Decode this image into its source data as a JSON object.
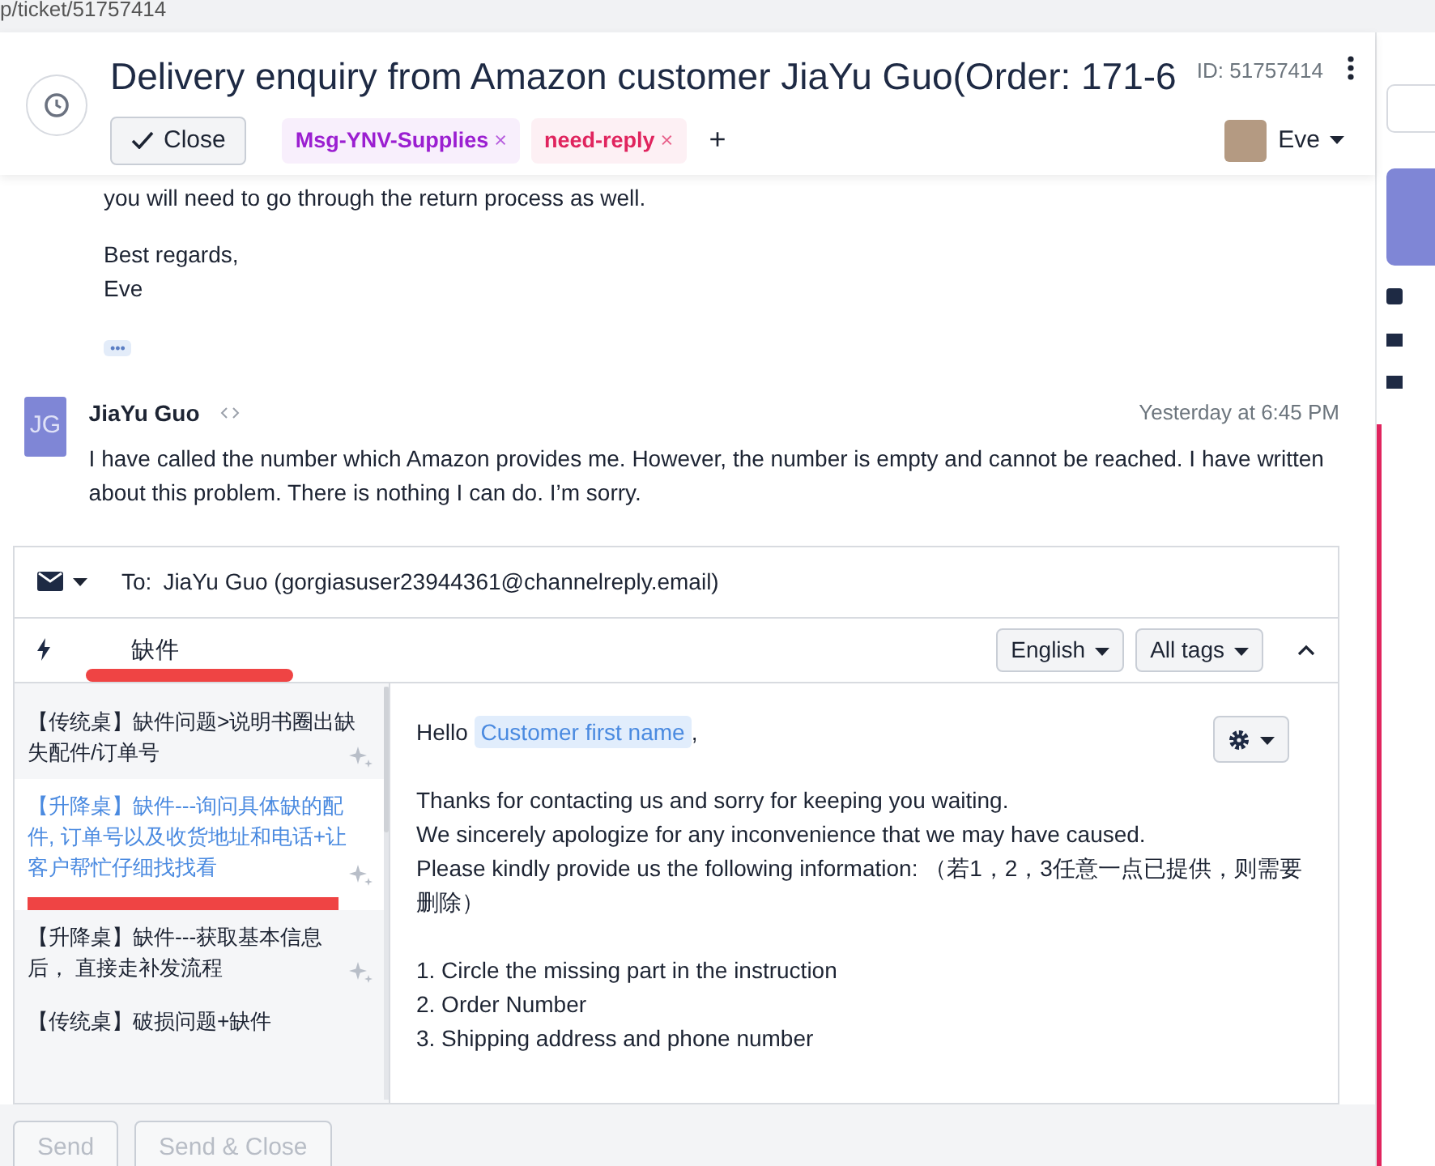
{
  "address_bar": {
    "url": "p/ticket/51757414"
  },
  "header": {
    "remove_tag": "×",
    "title": "Delivery enquiry from Amazon customer JiaYu Guo(Order: 171-6",
    "ticket_id": "ID: 51757414",
    "close_button": "Close",
    "add_tag": "+",
    "agent": "Eve",
    "tags": [
      {
        "label": "Msg-YNV-Supplies",
        "color": "#9b1fd1"
      },
      {
        "label": "need-reply",
        "color": "#e0245e"
      }
    ]
  },
  "previous_message": {
    "body": "you will need to go through the return process as well.",
    "signoff": [
      "Best regards,",
      "Eve"
    ],
    "more": "•••"
  },
  "message": {
    "initials": "JG",
    "author": "JiaYu Guo",
    "time": "Yesterday at 6:45 PM",
    "body": "I have called the number which Amazon provides me. However, the number is empty and cannot be reached. I have written about this problem. There is nothing I can do. I’m sorry."
  },
  "composer": {
    "to_label": "To:",
    "to": "JiaYu Guo (gorgiasuser23944361@channelreply.email)",
    "search": "缺件",
    "search_underlined": true,
    "language": "English",
    "tags_filter": "All tags",
    "macros": [
      {
        "text": "【传统桌】缺件问题>说明书圈出缺失配件/订单号",
        "selected": false,
        "underlined": false
      },
      {
        "text": "【升降桌】缺件---询问具体缺的配件, 订单号以及收货地址和电话+让客户帮忙仔细找找看",
        "selected": true,
        "underlined": true
      },
      {
        "text": "【升降桌】缺件---获取基本信息后， 直接走补发流程",
        "selected": false,
        "underlined": false
      },
      {
        "text": "【传统桌】破损问题+缺件",
        "selected": false,
        "underlined": false
      }
    ],
    "greeting": "Hello",
    "variable": "Customer first name",
    "comma": ",",
    "paragraphs": [
      [
        "Thanks for contacting us and sorry for keeping you waiting.",
        "We sincerely apologize for any inconvenience that we may have caused.",
        "Please kindly provide us the following information: （若1，2，3任意一点已提供，则需要删除）"
      ],
      [
        "1. Circle the missing part in the instruction",
        "2. Order Number",
        "3. Shipping address and phone number"
      ]
    ],
    "send": "Send",
    "send_close": "Send & Close",
    "send_disabled": true
  }
}
